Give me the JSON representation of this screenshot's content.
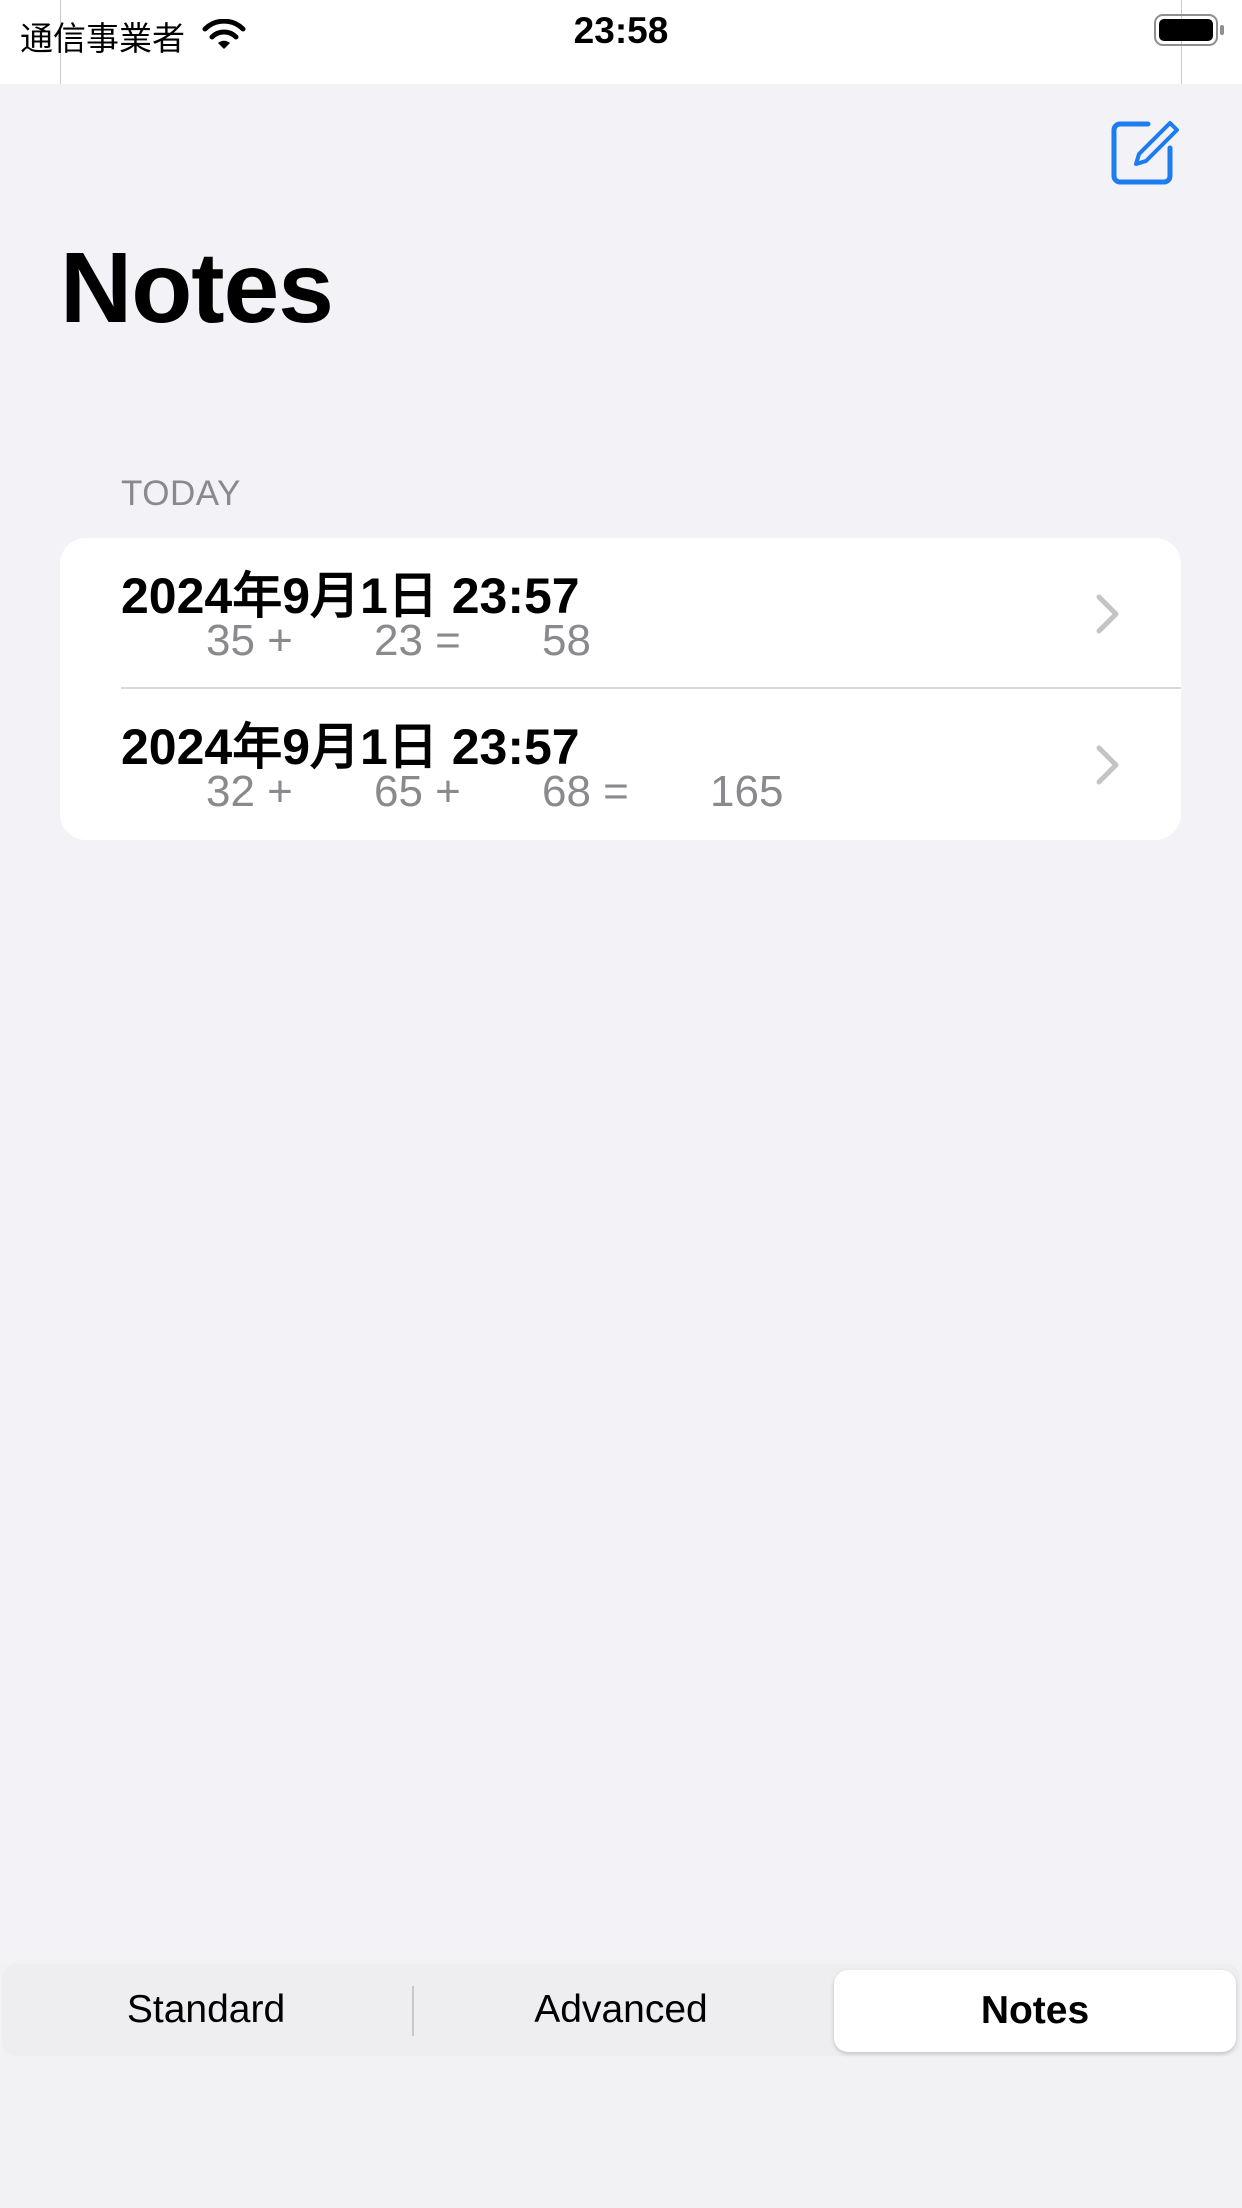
{
  "status_bar": {
    "carrier": "通信事業者",
    "time": "23:58"
  },
  "navigation": {
    "title": "Notes",
    "compose_icon": "compose-icon",
    "accent_color": "#1C7CF2"
  },
  "section": {
    "header": "TODAY"
  },
  "notes": [
    {
      "title": "2024年9月1日 23:57",
      "operands": [
        "35 +",
        "23 =",
        "58"
      ]
    },
    {
      "title": "2024年9月1日 23:57",
      "operands": [
        "32 +",
        "65 +",
        "68 =",
        "165"
      ]
    }
  ],
  "segmented_control": {
    "segments": [
      "Standard",
      "Advanced",
      "Notes"
    ],
    "selected": "Notes"
  }
}
